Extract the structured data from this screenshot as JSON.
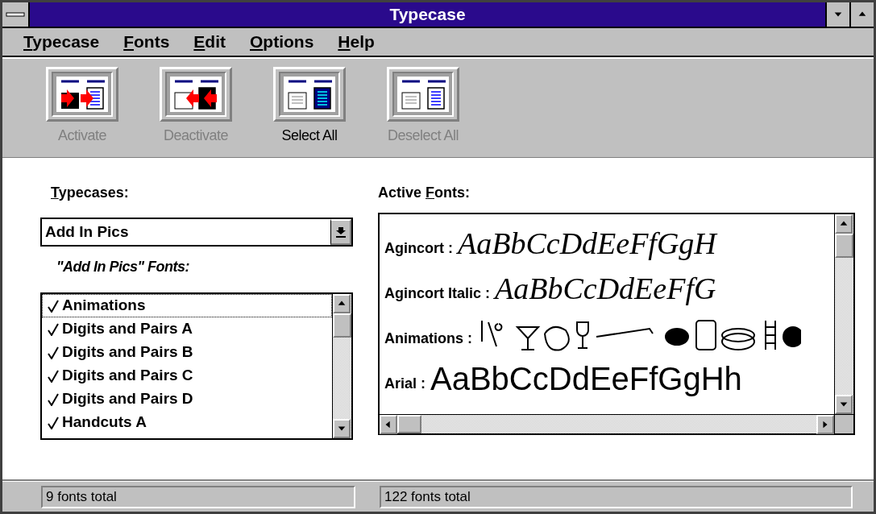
{
  "window": {
    "title": "Typecase"
  },
  "menu": [
    {
      "key": "T",
      "post": "ypecase"
    },
    {
      "key": "F",
      "post": "onts"
    },
    {
      "key": "E",
      "post": "dit"
    },
    {
      "key": "O",
      "post": "ptions"
    },
    {
      "key": "H",
      "post": "elp"
    }
  ],
  "toolbar": [
    {
      "label": "Activate",
      "kind": "activate",
      "disabled": true
    },
    {
      "label": "Deactivate",
      "kind": "deactivate",
      "disabled": true
    },
    {
      "label": "Select All",
      "kind": "select_all",
      "disabled": false
    },
    {
      "label": "Deselect All",
      "kind": "deselect_all",
      "disabled": true
    }
  ],
  "typecases": {
    "label": {
      "key": "T",
      "post": "ypecases:"
    },
    "value": "Add In Pics",
    "fonts_label": "\"Add In Pics\" Fonts:",
    "fonts": [
      {
        "name": "Animations",
        "checked": true,
        "focused": true
      },
      {
        "name": "Digits and Pairs A",
        "checked": true,
        "focused": false
      },
      {
        "name": "Digits and Pairs B",
        "checked": true,
        "focused": false
      },
      {
        "name": "Digits and Pairs C",
        "checked": true,
        "focused": false
      },
      {
        "name": "Digits and Pairs D",
        "checked": true,
        "focused": false
      },
      {
        "name": "Handcuts A",
        "checked": true,
        "focused": false
      }
    ]
  },
  "active_fonts": {
    "label": {
      "pre": "Active ",
      "key": "F",
      "post": "onts:"
    },
    "fonts": [
      {
        "name": "Agincort :",
        "kind": "script",
        "sample": "AaBbCcDdEeFfGgH"
      },
      {
        "name": "Agincort Italic :",
        "kind": "script",
        "sample": "AaBbCcDdEeFfG"
      },
      {
        "name": "Animations :",
        "kind": "pictures"
      },
      {
        "name": "Arial :",
        "kind": "sans",
        "sample": "AaBbCcDdEeFfGgHh"
      }
    ]
  },
  "status_bar": [
    "9 fonts total",
    "122 fonts total"
  ]
}
